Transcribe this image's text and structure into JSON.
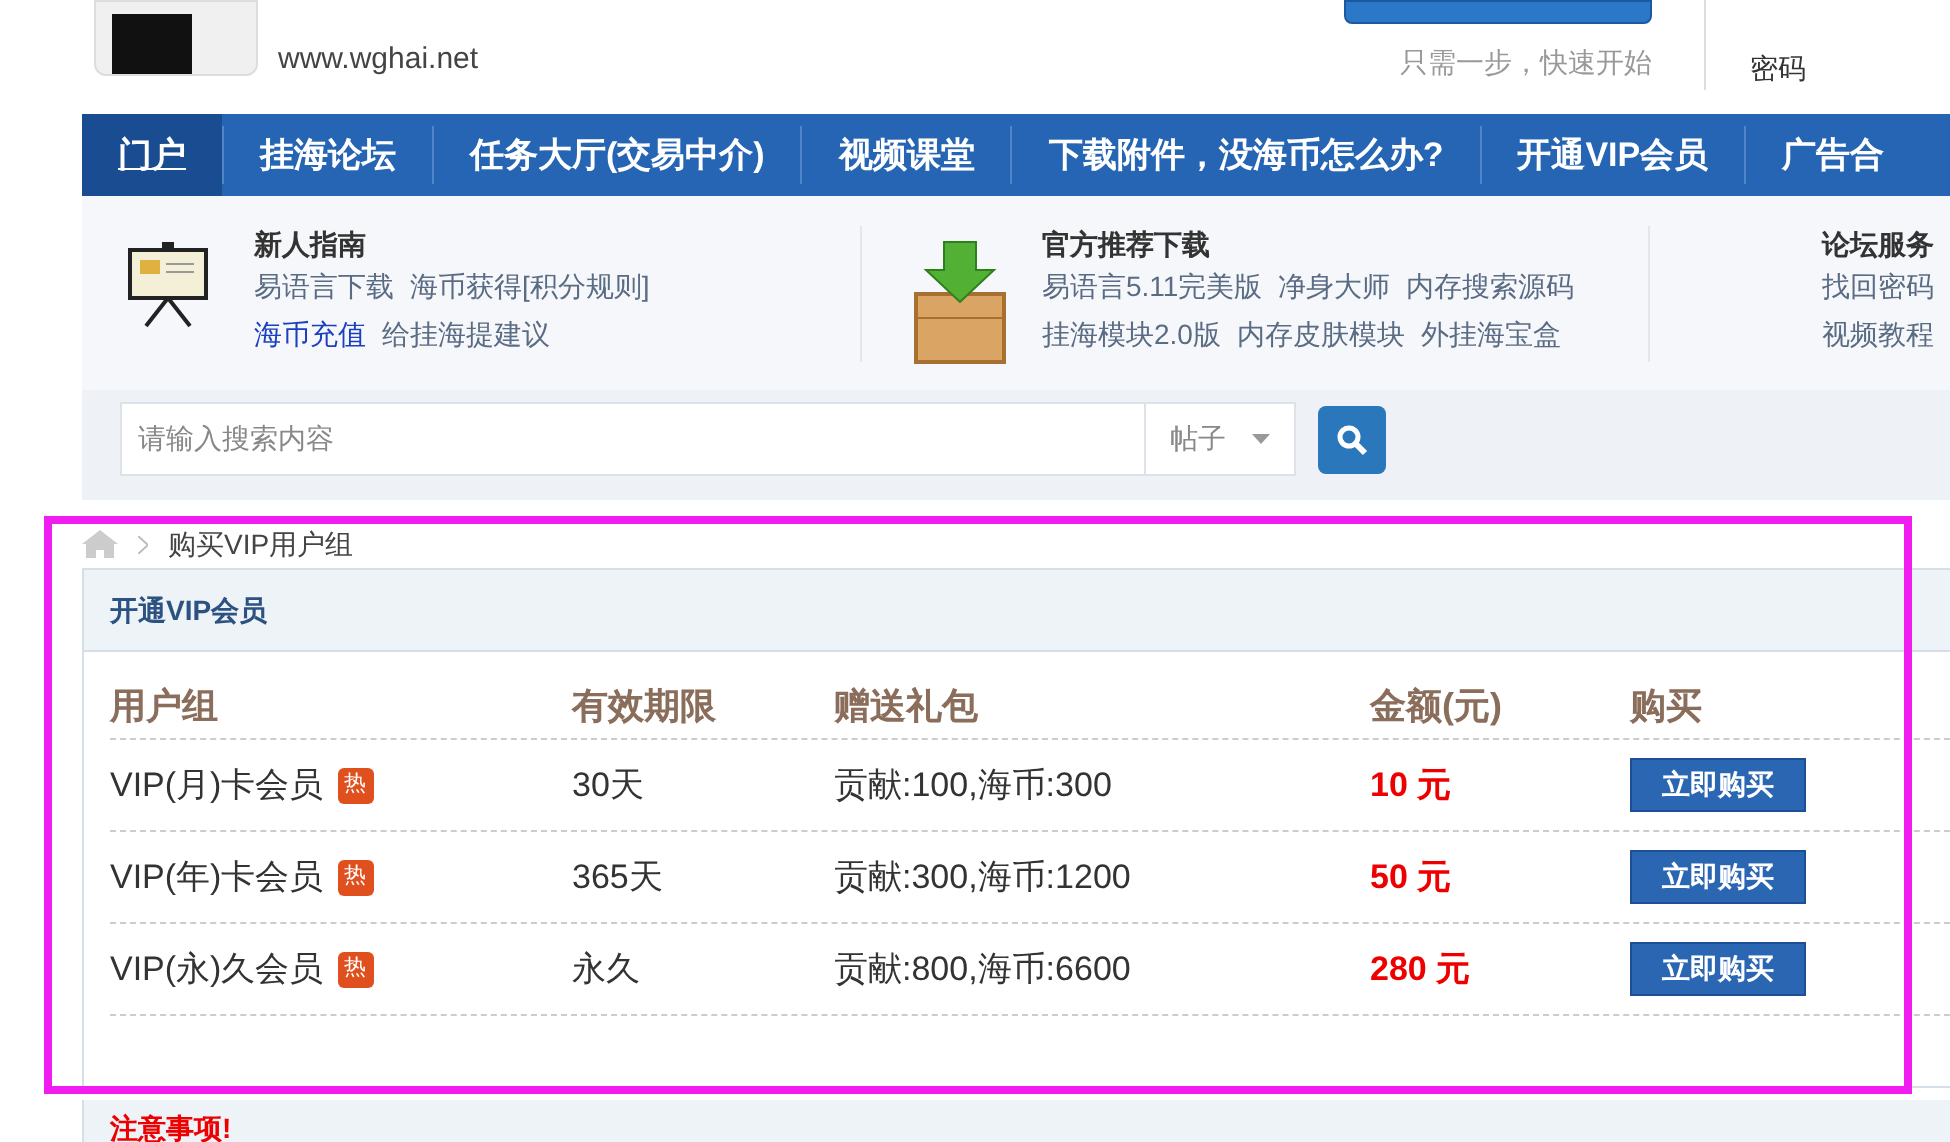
{
  "header": {
    "site_url": "www.wghai.net",
    "login_hint": "只需一步，快速开始",
    "password_label": "密码"
  },
  "nav": [
    {
      "label": "门户",
      "selected": true
    },
    {
      "label": "挂海论坛",
      "selected": false
    },
    {
      "label": "任务大厅(交易中介)",
      "selected": false
    },
    {
      "label": "视频课堂",
      "selected": false
    },
    {
      "label": "下载附件，没海币怎么办?",
      "selected": false
    },
    {
      "label": "开通VIP会员",
      "selected": false
    },
    {
      "label": "广告合",
      "selected": false
    }
  ],
  "quick_links": [
    {
      "title": "新人指南",
      "kind": "guide",
      "rows": [
        [
          {
            "label": "易语言下载",
            "highlight": false
          },
          {
            "label": "海币获得[积分规则]",
            "highlight": false
          }
        ],
        [
          {
            "label": "海币充值",
            "highlight": true
          },
          {
            "label": "给挂海提建议",
            "highlight": false
          }
        ]
      ]
    },
    {
      "title": "官方推荐下载",
      "kind": "download",
      "rows": [
        [
          {
            "label": "易语言5.11完美版",
            "highlight": false
          },
          {
            "label": "净身大师",
            "highlight": false
          },
          {
            "label": "内存搜索源码",
            "highlight": false
          }
        ],
        [
          {
            "label": "挂海模块2.0版",
            "highlight": false
          },
          {
            "label": "内存皮肤模块",
            "highlight": false
          },
          {
            "label": "外挂海宝盒",
            "highlight": false
          }
        ]
      ]
    },
    {
      "title": "论坛服务",
      "kind": "none",
      "rows": [
        [
          {
            "label": "找回密码",
            "highlight": false
          }
        ],
        [
          {
            "label": "视频教程",
            "highlight": false
          }
        ]
      ]
    }
  ],
  "search": {
    "placeholder": "请输入搜索内容",
    "scope": "帖子"
  },
  "breadcrumb": "购买VIP用户组",
  "panel": {
    "title": "开通VIP会员",
    "columns": [
      "用户组",
      "有效期限",
      "赠送礼包",
      "金额(元)",
      "购买"
    ],
    "rows": [
      {
        "group": "VIP(月)卡会员",
        "hot": true,
        "hot_label": "热",
        "period": "30天",
        "gift": "贡献:100,海币:300",
        "price": "10 元",
        "action": "立即购买"
      },
      {
        "group": "VIP(年)卡会员",
        "hot": true,
        "hot_label": "热",
        "period": "365天",
        "gift": "贡献:300,海币:1200",
        "price": "50 元",
        "action": "立即购买"
      },
      {
        "group": "VIP(永)久会员",
        "hot": true,
        "hot_label": "热",
        "period": "永久",
        "gift": "贡献:800,海币:6600",
        "price": "280 元",
        "action": "立即购买"
      }
    ]
  },
  "notice_title": "注意事项!"
}
